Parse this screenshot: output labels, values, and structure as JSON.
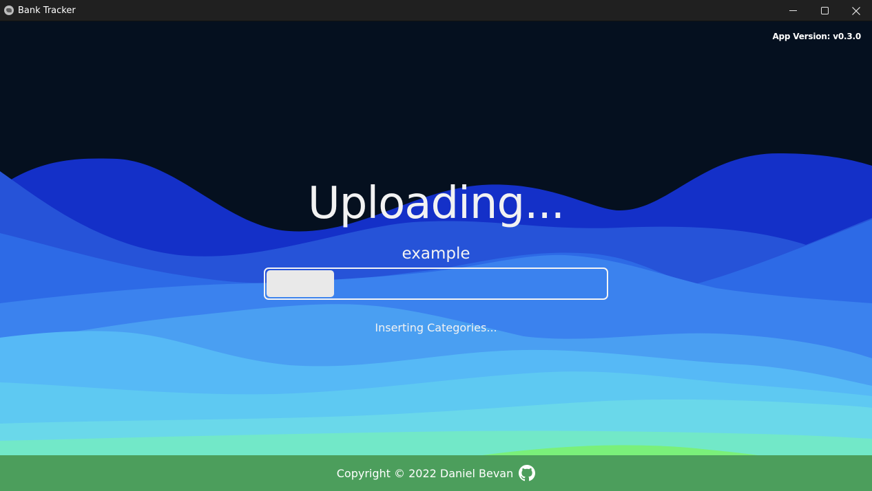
{
  "window": {
    "title": "Bank Tracker",
    "icon": "globe-icon",
    "controls": [
      "minimize-icon",
      "maximize-icon",
      "close-icon"
    ]
  },
  "app": {
    "version_text": "App Version: v0.3.0"
  },
  "upload": {
    "heading": "Uploading...",
    "filename": "example",
    "progress": 0.2,
    "status": "Inserting Categories..."
  },
  "footer": {
    "copyright": "Copyright © 2022 Daniel Bevan",
    "link_icon": "github-icon"
  },
  "colors": {
    "background": "#05101f",
    "wave_dark": "#1430c8",
    "wave_mid": "#3b7ee8",
    "wave_light": "#5ec9f2",
    "wave_teal": "#72e8c8",
    "footer": "#48964f"
  }
}
